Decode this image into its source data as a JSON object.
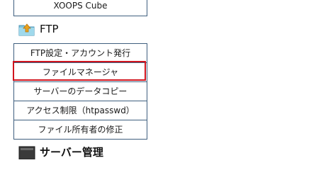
{
  "top_item": {
    "label": "XOOPS Cube"
  },
  "ftp_section": {
    "title": "FTP",
    "items": [
      {
        "label": "FTP設定・アカウント発行"
      },
      {
        "label": "ファイルマネージャ"
      },
      {
        "label": "サーバーのデータコピー"
      },
      {
        "label": "アクセス制限（htpasswd）"
      },
      {
        "label": "ファイル所有者の修正"
      }
    ],
    "highlighted_index": 1
  },
  "server_section": {
    "title": "サーバー管理"
  },
  "colors": {
    "border": "#3f5f7f",
    "highlight": "#d0141e"
  },
  "icons": {
    "ftp": "folder-upload-icon",
    "server": "server-icon"
  }
}
